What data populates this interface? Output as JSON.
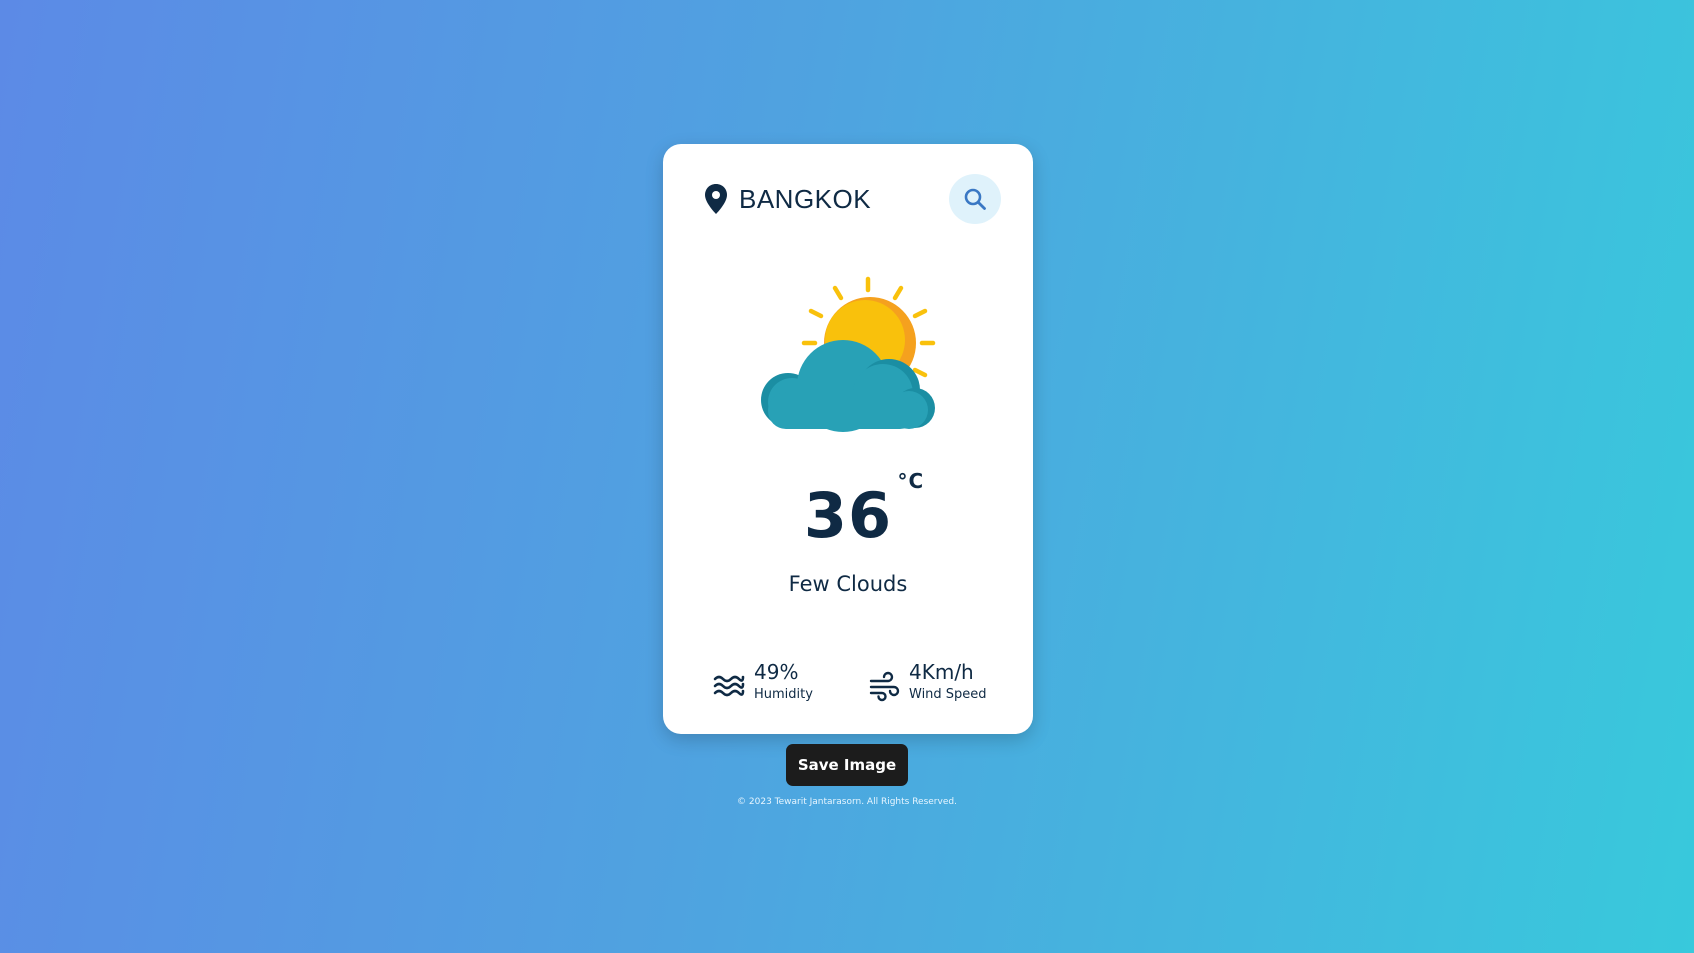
{
  "location": {
    "city": "BANGKOK",
    "icon": "map-pin-icon"
  },
  "search": {
    "icon": "search-icon"
  },
  "weather": {
    "icon": "sun-behind-cloud-icon",
    "temperature": "36",
    "unit": "°C",
    "description": "Few Clouds"
  },
  "stats": {
    "humidity": {
      "value": "49%",
      "label": "Humidity",
      "icon": "waves-icon"
    },
    "wind": {
      "value": "4Km/h",
      "label": "Wind Speed",
      "icon": "wind-icon"
    }
  },
  "actions": {
    "save_label": "Save Image"
  },
  "footer": {
    "copyright": "© 2023 Tewarit Jantarasorn. All Rights Reserved."
  },
  "colors": {
    "text": "#0f2a44",
    "sun": "#f9c10c",
    "sun_shade": "#f5a11e",
    "cloud": "#28a1b6",
    "cloud_shade": "#1b8ea3",
    "button": "#1c1c1c"
  }
}
